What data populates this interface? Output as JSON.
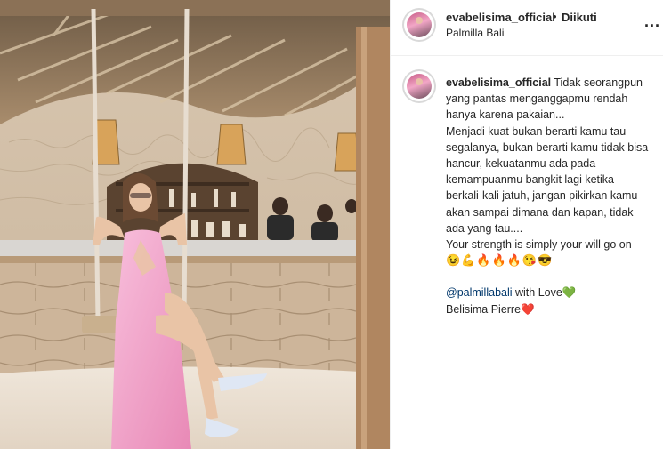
{
  "post": {
    "username": "evabelisima_official",
    "follow_separator": "•",
    "follow_status": "Diikuti",
    "location": "Palmilla Bali",
    "more_label": "..."
  },
  "caption": {
    "username": "evabelisima_official",
    "line1": "Tidak seorangpun yang pantas menganggapmu rendah hanya karena pakaian...",
    "line2": "Menjadi kuat bukan berarti kamu tau segalanya, bukan berarti kamu tidak bisa hancur, kekuatanmu ada pada kemampuanmu bangkit lagi ketika berkali-kali jatuh, jangan pikirkan kamu akan sampai dimana dan kapan, tidak ada yang tau....",
    "line3": "Your strength is simply your will go on",
    "emojis": "😉💪🔥🔥🔥😘😎",
    "mention": "@palmillabali",
    "mention_suffix": " with Love",
    "green_heart": "💚",
    "signature": "Belisima Pierre",
    "red_heart": "❤️"
  },
  "colors": {
    "text": "#262626",
    "mention": "#00376b",
    "divider": "#efefef",
    "dress": "#f4a9cf"
  }
}
